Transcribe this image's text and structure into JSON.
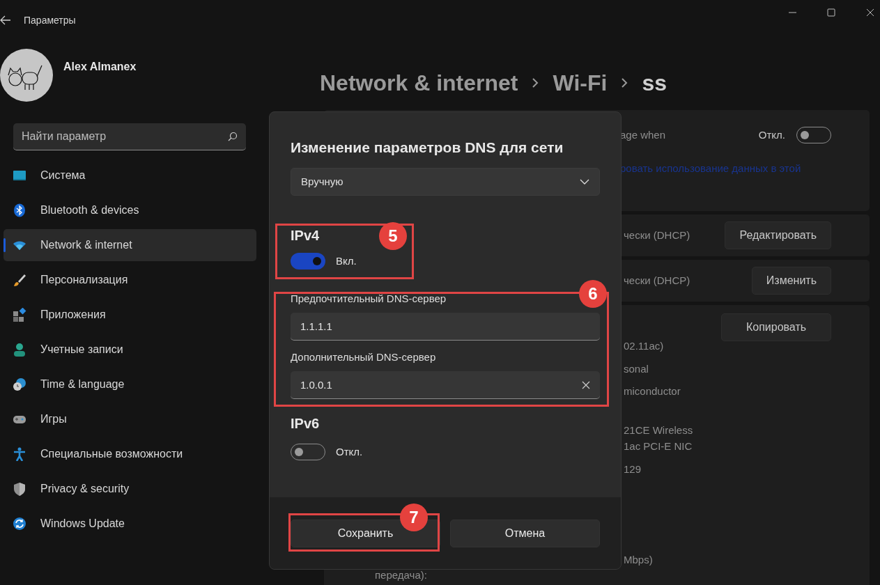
{
  "window": {
    "title": "Параметры"
  },
  "profile": {
    "name": "Alex Almanex"
  },
  "search": {
    "placeholder": "Найти параметр"
  },
  "sidebar": {
    "items": [
      {
        "label": "Система",
        "kind": "system",
        "selected": false
      },
      {
        "label": "Bluetooth & devices",
        "kind": "bluetooth",
        "selected": false
      },
      {
        "label": "Network & internet",
        "kind": "network",
        "selected": true
      },
      {
        "label": "Персонализация",
        "kind": "brush",
        "selected": false
      },
      {
        "label": "Приложения",
        "kind": "apps",
        "selected": false
      },
      {
        "label": "Учетные записи",
        "kind": "accounts",
        "selected": false
      },
      {
        "label": "Time & language",
        "kind": "time",
        "selected": false
      },
      {
        "label": "Игры",
        "kind": "gaming",
        "selected": false
      },
      {
        "label": "Специальные возможности",
        "kind": "accessibility",
        "selected": false
      },
      {
        "label": "Privacy & security",
        "kind": "privacy",
        "selected": false
      },
      {
        "label": "Windows Update",
        "kind": "update",
        "selected": false
      }
    ]
  },
  "breadcrumb": [
    "Network & internet",
    "Wi-Fi",
    "ss"
  ],
  "metered_card": {
    "text": "age when",
    "toggle_label": "Откл.",
    "on": false,
    "link": "ровать использование данных в этой"
  },
  "ip_rows": [
    {
      "value": "чески (DHCP)",
      "button": "Редактировать"
    },
    {
      "value": "чески (DHCP)",
      "button": "Изменить"
    }
  ],
  "properties": {
    "button": "Копировать",
    "rows": [
      {
        "lines": [
          "02.11ac)"
        ]
      },
      {
        "lines": [
          "sonal"
        ]
      },
      {
        "lines": [
          "miconductor"
        ]
      },
      {
        "lines": [
          "21CE Wireless",
          "1ac PCI-E NIC"
        ]
      },
      {
        "lines": [
          "129"
        ]
      },
      {
        "lines": [
          "Mbps)"
        ],
        "label": "передача):"
      }
    ]
  },
  "dialog": {
    "title": "Изменение параметров DNS для сети",
    "mode": "Вручную",
    "ipv4": {
      "heading": "IPv4",
      "on": true,
      "toggle_label": "Вкл.",
      "fields": [
        {
          "label": "Предпочтительный DNS-сервер",
          "value": "1.1.1.1",
          "clearable": false
        },
        {
          "label": "Дополнительный DNS-сервер",
          "value": "1.0.0.1",
          "clearable": true
        }
      ]
    },
    "ipv6": {
      "heading": "IPv6",
      "on": false,
      "toggle_label": "Откл."
    },
    "buttons": [
      "Сохранить",
      "Отмена"
    ]
  },
  "annotations": [
    {
      "number": "5"
    },
    {
      "number": "6"
    },
    {
      "number": "7"
    }
  ]
}
